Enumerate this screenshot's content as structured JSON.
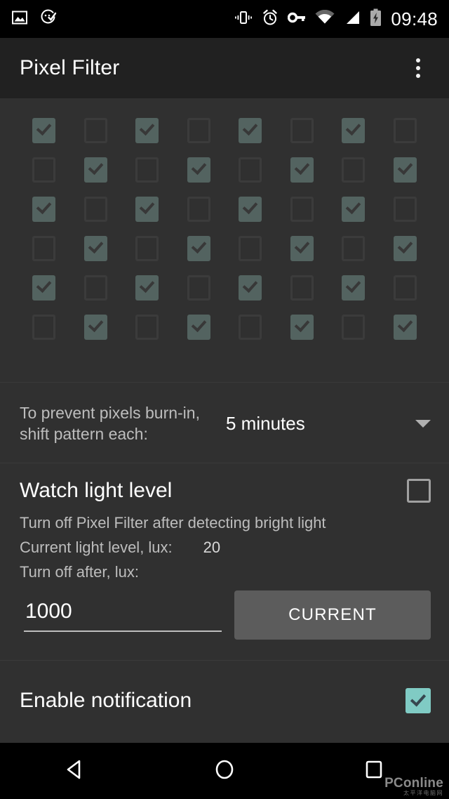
{
  "status_bar": {
    "time": "09:48",
    "left_icons": [
      {
        "name": "image-icon"
      },
      {
        "name": "clock-check-icon"
      }
    ],
    "right_icons": [
      {
        "name": "vibrate-icon"
      },
      {
        "name": "alarm-icon"
      },
      {
        "name": "vpn-key-icon"
      },
      {
        "name": "wifi-icon"
      },
      {
        "name": "signal-icon"
      },
      {
        "name": "battery-charging-icon"
      }
    ]
  },
  "app_bar": {
    "title": "Pixel Filter",
    "overflow_icon": "more-vert-icon"
  },
  "pixel_grid": {
    "columns": 8,
    "rows": 6,
    "checked_color": "#536360",
    "unchecked_border_color": "#3b3b3b",
    "pattern": [
      [
        true,
        false,
        true,
        false,
        true,
        false,
        true,
        false
      ],
      [
        false,
        true,
        false,
        true,
        false,
        true,
        false,
        true
      ],
      [
        true,
        false,
        true,
        false,
        true,
        false,
        true,
        false
      ],
      [
        false,
        true,
        false,
        true,
        false,
        true,
        false,
        true
      ],
      [
        true,
        false,
        true,
        false,
        true,
        false,
        true,
        false
      ],
      [
        false,
        true,
        false,
        true,
        false,
        true,
        false,
        true
      ]
    ]
  },
  "shift_pattern": {
    "label": "To prevent pixels burn-in, shift pattern each:",
    "label_line1": "To prevent pixels burn-in,",
    "label_line2": "shift pattern each:",
    "selected": "5 minutes",
    "dropdown_icon": "chevron-down-icon"
  },
  "watch_light_level": {
    "title": "Watch light level",
    "checked": false,
    "description": "Turn off Pixel Filter after detecting bright light",
    "current_label": "Current light level, lux:",
    "current_value": "20",
    "turn_off_label": "Turn off after, lux:",
    "input_value": "1000",
    "input_placeholder": "1000",
    "button_label": "CURRENT"
  },
  "enable_notification": {
    "title": "Enable notification",
    "checked": true,
    "accent_color": "#80cbc4"
  },
  "nav_bar": {
    "back_icon": "back-triangle-icon",
    "home_icon": "home-circle-icon",
    "recents_icon": "recents-square-icon"
  },
  "watermark": {
    "main": "PConline",
    "sub": "太平洋电脑网"
  }
}
